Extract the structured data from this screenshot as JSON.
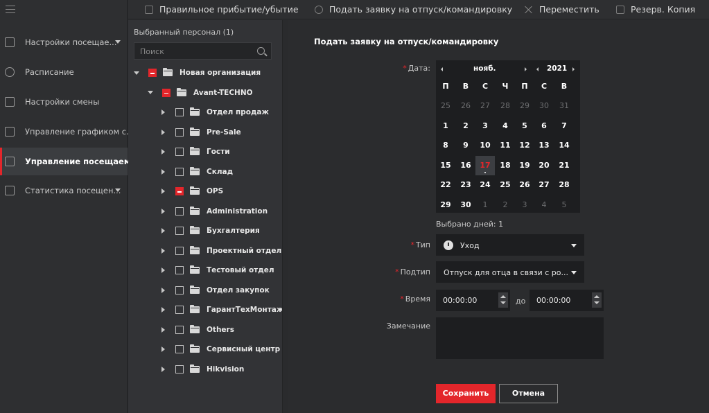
{
  "toolbar": {
    "items": [
      {
        "label": "Правильное прибытие/убытие",
        "icon": "calendar-icon"
      },
      {
        "label": "Подать заявку на отпуск/командировку",
        "icon": "person-icon"
      },
      {
        "label": "Переместить",
        "icon": "close-icon"
      },
      {
        "label": "Резерв. Копия",
        "icon": "export-icon"
      }
    ]
  },
  "sidebar": {
    "items": [
      {
        "label": "Настройки посещае...",
        "icon": "settings-icon",
        "expandable": true
      },
      {
        "label": "Расписание",
        "icon": "clock-icon"
      },
      {
        "label": "Настройки смены",
        "icon": "shift-icon"
      },
      {
        "label": "Управление графиком с...",
        "icon": "schedule-icon"
      },
      {
        "label": "Управление посещаемо...",
        "icon": "attendance-icon",
        "active": true
      },
      {
        "label": "Статистика посещен...",
        "icon": "stats-icon",
        "expandable": true
      }
    ]
  },
  "personnel": {
    "title": "Выбранный персонал (1)",
    "search_placeholder": "Поиск",
    "tree": [
      {
        "label": "Новая организация",
        "level": 0,
        "expanded": true,
        "state": "partial"
      },
      {
        "label": "Avant-TECHNO",
        "level": 1,
        "expanded": true,
        "state": "partial"
      },
      {
        "label": "Отдел продаж",
        "level": 2,
        "state": "none"
      },
      {
        "label": "Pre-Sale",
        "level": 2,
        "state": "none"
      },
      {
        "label": "Гости",
        "level": 2,
        "state": "none"
      },
      {
        "label": "Склад",
        "level": 2,
        "state": "none"
      },
      {
        "label": "OPS",
        "level": 2,
        "state": "partial"
      },
      {
        "label": "Administration",
        "level": 2,
        "state": "none"
      },
      {
        "label": "Бухгалтерия",
        "level": 2,
        "state": "none"
      },
      {
        "label": "Проектный отдел",
        "level": 2,
        "state": "none"
      },
      {
        "label": "Тестовый отдел",
        "level": 2,
        "state": "none"
      },
      {
        "label": "Отдел закупок",
        "level": 2,
        "state": "none"
      },
      {
        "label": "ГарантТехМонтаж",
        "level": 2,
        "state": "none"
      },
      {
        "label": "Others",
        "level": 2,
        "state": "none"
      },
      {
        "label": "Сервисный центр",
        "level": 2,
        "state": "none"
      },
      {
        "label": "Hikvision",
        "level": 2,
        "state": "none"
      }
    ]
  },
  "form": {
    "title": "Подать заявку на отпуск/командировку",
    "date_label": "Дата:",
    "calendar": {
      "month": "нояб.",
      "year": "2021",
      "weekdays": [
        "П",
        "В",
        "С",
        "Ч",
        "П",
        "С",
        "В"
      ],
      "days": [
        [
          "25",
          "26",
          "27",
          "28",
          "29",
          "30",
          "31"
        ],
        [
          "1",
          "2",
          "3",
          "4",
          "5",
          "6",
          "7"
        ],
        [
          "8",
          "9",
          "10",
          "11",
          "12",
          "13",
          "14"
        ],
        [
          "15",
          "16",
          "17",
          "18",
          "19",
          "20",
          "21"
        ],
        [
          "22",
          "23",
          "24",
          "25",
          "26",
          "27",
          "28"
        ],
        [
          "29",
          "30",
          "1",
          "2",
          "3",
          "4",
          "5"
        ]
      ],
      "selected_day": "17"
    },
    "days_selected": "Выбрано дней: 1",
    "type_label": "Тип",
    "type_value": "Уход",
    "subtype_label": "Подтип",
    "subtype_value": "Отпуск для отца в связи с ро...",
    "time_label": "Время",
    "time_from": "00:00:00",
    "time_to_label": "до",
    "time_to": "00:00:00",
    "remark_label": "Замечание",
    "save_label": "Сохранить",
    "cancel_label": "Отмена"
  },
  "colors": {
    "accent": "#e3262b",
    "background": "#2b2c2e",
    "field": "#1d1e20"
  }
}
